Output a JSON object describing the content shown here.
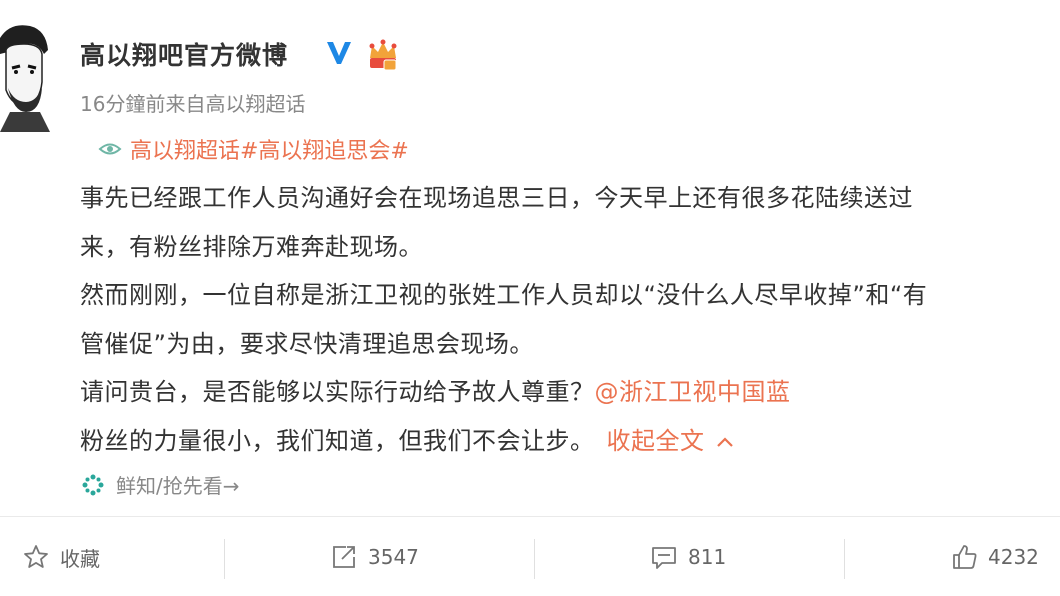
{
  "post": {
    "author": "高以翔吧官方微博",
    "meta": "16分鐘前来自高以翔超话",
    "topics": "高以翔超话#高以翔追思会#",
    "lines": [
      "事先已经跟工作人员沟通好会在现场追思三日，今天早上还有很多花陆续送过",
      "来，有粉丝排除万难奔赴现场。",
      "然而刚刚，一位自称是浙江卫视的张姓工作人员却以“没什么人尽早收掉”和“有",
      "管催促”为由，要求尽快清理追思会现场。"
    ],
    "line5_text": "请问贵台，是否能够以实际行动给予故人尊重？",
    "mention": "@浙江卫视中国蓝",
    "line6_text": "粉丝的力量很小，我们知道，但我们不会让步。",
    "collapse_label": "收起全文",
    "source": "鲜知/抢先看→"
  },
  "actions": {
    "favorite_label": "收藏",
    "repost_count": "3547",
    "comment_count": "811",
    "like_count": "4232"
  },
  "colors": {
    "link": "#eb7350",
    "verified": "#1e88e5",
    "muted": "#888888"
  },
  "icons": {
    "verified": "verified-v-icon",
    "vip": "vip-crown-icon",
    "topic": "eye-icon",
    "source": "source-flower-icon",
    "favorite": "star-icon",
    "repost": "repost-icon",
    "comment": "comment-icon",
    "like": "thumbs-up-icon"
  }
}
